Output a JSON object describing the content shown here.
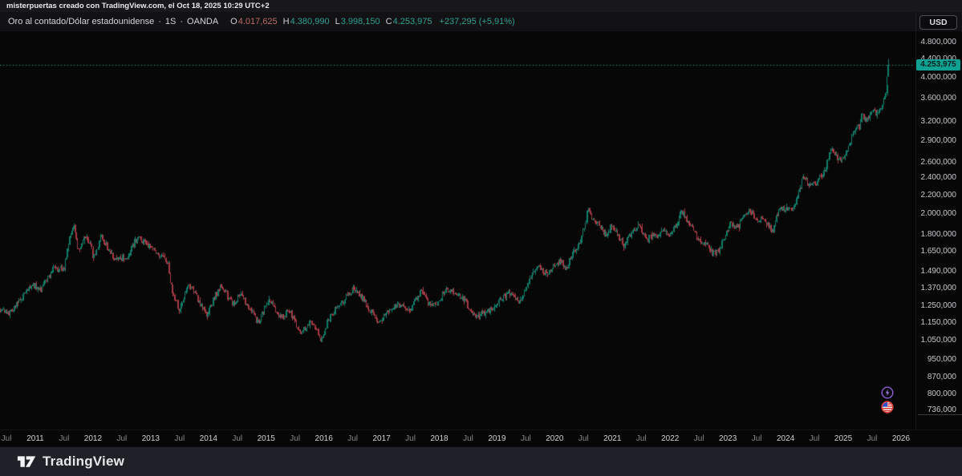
{
  "attribution": {
    "text": "misterpuertas creado con TradingView.com, el Oct 18, 2025 10:29 UTC+2"
  },
  "legend": {
    "symbol": "Oro al contado/Dólar estadounidense",
    "separator": "·",
    "timeframe": "1S",
    "exchange": "OANDA",
    "ohlc": {
      "o_label": "O",
      "o_value": "4.017,625",
      "h_label": "H",
      "h_value": "4.380,990",
      "l_label": "L",
      "l_value": "3.998,150",
      "c_label": "C",
      "c_value": "4.253,975",
      "change": "+237,295 (+5,91%)"
    }
  },
  "price_axis": {
    "currency_button": "USD",
    "last_price_label": "4.253,975",
    "ticks": [
      {
        "label": "4.800,000",
        "value": 4800
      },
      {
        "label": "4.400,000",
        "value": 4400
      },
      {
        "label": "4.000,000",
        "value": 4000
      },
      {
        "label": "3.600,000",
        "value": 3600
      },
      {
        "label": "3.200,000",
        "value": 3200
      },
      {
        "label": "2.900,000",
        "value": 2900
      },
      {
        "label": "2.600,000",
        "value": 2600
      },
      {
        "label": "2.400,000",
        "value": 2400
      },
      {
        "label": "2.200,000",
        "value": 2200
      },
      {
        "label": "2.000,000",
        "value": 2000
      },
      {
        "label": "1.800,000",
        "value": 1800
      },
      {
        "label": "1.650,000",
        "value": 1650
      },
      {
        "label": "1.490,000",
        "value": 1490
      },
      {
        "label": "1.370,000",
        "value": 1370
      },
      {
        "label": "1.250,000",
        "value": 1250
      },
      {
        "label": "1.150,000",
        "value": 1150
      },
      {
        "label": "1.050,000",
        "value": 1050
      },
      {
        "label": "950,000",
        "value": 950
      },
      {
        "label": "870,000",
        "value": 870
      },
      {
        "label": "800,000",
        "value": 800
      },
      {
        "label": "736,000",
        "value": 736
      }
    ]
  },
  "time_axis": {
    "labels": [
      "Jul",
      "2011",
      "Jul",
      "2012",
      "Jul",
      "2013",
      "Jul",
      "2014",
      "Jul",
      "2015",
      "Jul",
      "2016",
      "Jul",
      "2017",
      "Jul",
      "2018",
      "Jul",
      "2019",
      "Jul",
      "2020",
      "Jul",
      "2021",
      "Jul",
      "2022",
      "Jul",
      "2023",
      "Jul",
      "2024",
      "Jul",
      "2025",
      "Jul",
      "2026"
    ],
    "start_year_fraction": 2010.5,
    "step_years": 0.5
  },
  "events": {
    "flash_icon_color": "#8e5cd9",
    "flag_ring_color": "#e04038"
  },
  "footer": {
    "logo_text": "TradingView"
  },
  "chart_data": {
    "type": "candlestick",
    "title": "Oro al contado/Dólar estadounidense",
    "timeframe": "1S (weekly)",
    "exchange": "OANDA",
    "currency": "USD",
    "scale": "logarithmic",
    "ylim": [
      736,
      4800
    ],
    "x_range_years": [
      2010.388,
      2025.785
    ],
    "grid": "off",
    "up_color": "#0f7d69",
    "down_color": "#a73a44",
    "price_line_color": "#2fa092",
    "price_line_value": 4253.975,
    "last_candle": {
      "open": 4017.625,
      "high": 4380.99,
      "low": 3998.15,
      "close": 4253.975,
      "change_abs": 237.295,
      "change_pct": 5.91
    },
    "price_path": [
      [
        2010.39,
        1225
      ],
      [
        2010.55,
        1205
      ],
      [
        2010.75,
        1300
      ],
      [
        2010.95,
        1390
      ],
      [
        2011.1,
        1360
      ],
      [
        2011.3,
        1505
      ],
      [
        2011.5,
        1510
      ],
      [
        2011.62,
        1830
      ],
      [
        2011.67,
        1880
      ],
      [
        2011.74,
        1640
      ],
      [
        2011.85,
        1780
      ],
      [
        2011.95,
        1720
      ],
      [
        2012.0,
        1590
      ],
      [
        2012.15,
        1770
      ],
      [
        2012.38,
        1570
      ],
      [
        2012.6,
        1610
      ],
      [
        2012.78,
        1780
      ],
      [
        2012.95,
        1690
      ],
      [
        2013.05,
        1660
      ],
      [
        2013.2,
        1590
      ],
      [
        2013.3,
        1550
      ],
      [
        2013.35,
        1380
      ],
      [
        2013.5,
        1210
      ],
      [
        2013.65,
        1400
      ],
      [
        2013.8,
        1300
      ],
      [
        2013.97,
        1190
      ],
      [
        2014.2,
        1385
      ],
      [
        2014.45,
        1250
      ],
      [
        2014.55,
        1335
      ],
      [
        2014.7,
        1230
      ],
      [
        2014.87,
        1145
      ],
      [
        2015.05,
        1295
      ],
      [
        2015.25,
        1170
      ],
      [
        2015.4,
        1220
      ],
      [
        2015.6,
        1085
      ],
      [
        2015.78,
        1155
      ],
      [
        2015.95,
        1055
      ],
      [
        2016.1,
        1180
      ],
      [
        2016.25,
        1245
      ],
      [
        2016.52,
        1365
      ],
      [
        2016.75,
        1255
      ],
      [
        2016.95,
        1130
      ],
      [
        2017.1,
        1220
      ],
      [
        2017.3,
        1255
      ],
      [
        2017.5,
        1230
      ],
      [
        2017.68,
        1350
      ],
      [
        2017.8,
        1270
      ],
      [
        2017.95,
        1260
      ],
      [
        2018.1,
        1350
      ],
      [
        2018.3,
        1335
      ],
      [
        2018.45,
        1280
      ],
      [
        2018.62,
        1180
      ],
      [
        2018.8,
        1200
      ],
      [
        2018.95,
        1250
      ],
      [
        2019.1,
        1310
      ],
      [
        2019.2,
        1330
      ],
      [
        2019.4,
        1275
      ],
      [
        2019.55,
        1410
      ],
      [
        2019.7,
        1540
      ],
      [
        2019.85,
        1470
      ],
      [
        2019.95,
        1510
      ],
      [
        2020.1,
        1570
      ],
      [
        2020.2,
        1500
      ],
      [
        2020.3,
        1620
      ],
      [
        2020.45,
        1740
      ],
      [
        2020.58,
        2040
      ],
      [
        2020.65,
        1940
      ],
      [
        2020.78,
        1900
      ],
      [
        2020.88,
        1780
      ],
      [
        2021.0,
        1900
      ],
      [
        2021.05,
        1830
      ],
      [
        2021.2,
        1700
      ],
      [
        2021.35,
        1830
      ],
      [
        2021.45,
        1890
      ],
      [
        2021.6,
        1740
      ],
      [
        2021.7,
        1800
      ],
      [
        2021.8,
        1760
      ],
      [
        2021.87,
        1855
      ],
      [
        2022.0,
        1800
      ],
      [
        2022.1,
        1870
      ],
      [
        2022.2,
        2030
      ],
      [
        2022.3,
        1930
      ],
      [
        2022.4,
        1850
      ],
      [
        2022.5,
        1750
      ],
      [
        2022.6,
        1715
      ],
      [
        2022.73,
        1630
      ],
      [
        2022.85,
        1650
      ],
      [
        2022.95,
        1790
      ],
      [
        2023.05,
        1920
      ],
      [
        2023.15,
        1840
      ],
      [
        2023.3,
        1990
      ],
      [
        2023.37,
        2030
      ],
      [
        2023.5,
        1930
      ],
      [
        2023.6,
        1940
      ],
      [
        2023.73,
        1860
      ],
      [
        2023.78,
        1830
      ],
      [
        2023.85,
        1990
      ],
      [
        2023.95,
        2060
      ],
      [
        2024.05,
        2030
      ],
      [
        2024.1,
        2020
      ],
      [
        2024.2,
        2160
      ],
      [
        2024.3,
        2390
      ],
      [
        2024.4,
        2330
      ],
      [
        2024.5,
        2320
      ],
      [
        2024.6,
        2400
      ],
      [
        2024.68,
        2500
      ],
      [
        2024.78,
        2740
      ],
      [
        2024.83,
        2780
      ],
      [
        2024.9,
        2630
      ],
      [
        2024.98,
        2640
      ],
      [
        2025.05,
        2750
      ],
      [
        2025.12,
        2900
      ],
      [
        2025.2,
        3020
      ],
      [
        2025.28,
        3120
      ],
      [
        2025.32,
        3320
      ],
      [
        2025.38,
        3220
      ],
      [
        2025.45,
        3320
      ],
      [
        2025.5,
        3350
      ],
      [
        2025.57,
        3330
      ],
      [
        2025.62,
        3360
      ],
      [
        2025.68,
        3450
      ],
      [
        2025.72,
        3640
      ],
      [
        2025.75,
        3780
      ],
      [
        2025.77,
        3960
      ],
      [
        2025.785,
        4254
      ]
    ]
  }
}
